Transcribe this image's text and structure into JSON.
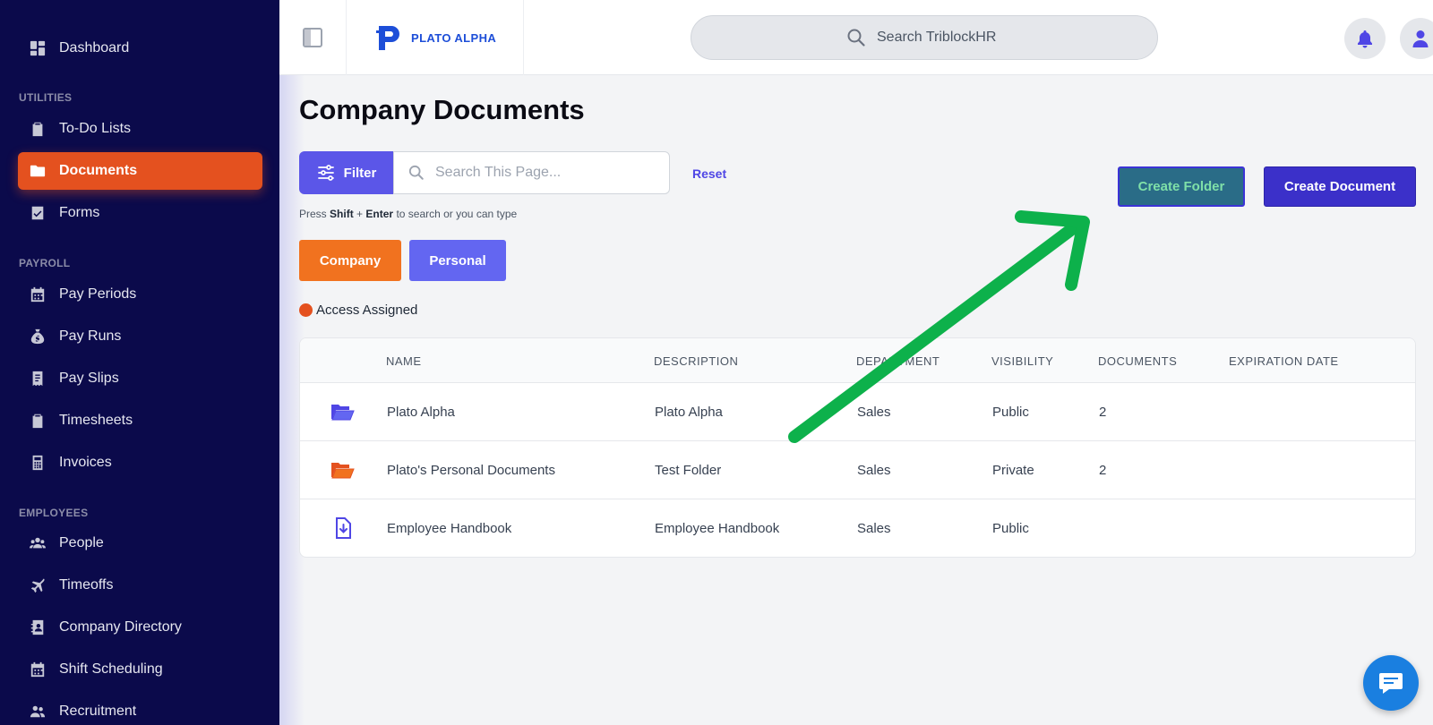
{
  "sidebar": {
    "items": [
      {
        "label": "Dashboard",
        "icon": "dashboard-icon"
      },
      {
        "label": "To-Do Lists",
        "icon": "clipboard-icon"
      },
      {
        "label": "Documents",
        "icon": "folder-icon",
        "active": true
      },
      {
        "label": "Forms",
        "icon": "form-check-icon"
      },
      {
        "label": "Pay Periods",
        "icon": "calendar-icon"
      },
      {
        "label": "Pay Runs",
        "icon": "money-bag-icon"
      },
      {
        "label": "Pay Slips",
        "icon": "receipt-icon"
      },
      {
        "label": "Timesheets",
        "icon": "clipboard-icon"
      },
      {
        "label": "Invoices",
        "icon": "calculator-icon"
      },
      {
        "label": "People",
        "icon": "people-icon"
      },
      {
        "label": "Timeoffs",
        "icon": "plane-icon"
      },
      {
        "label": "Company Directory",
        "icon": "address-book-icon"
      },
      {
        "label": "Shift Scheduling",
        "icon": "calendar-icon"
      },
      {
        "label": "Recruitment",
        "icon": "users-icon"
      }
    ],
    "sections": {
      "utilities": "UTILITIES",
      "payroll": "PAYROLL",
      "employees": "EMPLOYEES"
    }
  },
  "header": {
    "logo_text": "PLATO ALPHA",
    "search_placeholder": "Search TriblockHR"
  },
  "main": {
    "title": "Company Documents",
    "filter_label": "Filter",
    "search_placeholder": "Search This Page...",
    "reset_label": "Reset",
    "hint_prefix": "Press",
    "hint_key1": "Shift",
    "hint_plus": "+",
    "hint_key2": "Enter",
    "hint_suffix": "to search or you can type",
    "tabs": {
      "company": "Company",
      "personal": "Personal"
    },
    "access_label": "Access Assigned",
    "create_folder_label": "Create Folder",
    "create_document_label": "Create Document"
  },
  "table": {
    "headers": {
      "name": "NAME",
      "description": "DESCRIPTION",
      "department": "DEPARTMENT",
      "visibility": "VISIBILITY",
      "documents": "DOCUMENTS",
      "expiration": "EXPIRATION DATE"
    },
    "rows": [
      {
        "icon": "folder-open-icon",
        "name": "Plato Alpha",
        "description": "Plato Alpha",
        "department": "Sales",
        "visibility": "Public",
        "documents": "2",
        "expiration": ""
      },
      {
        "icon": "folder-open-icon",
        "name": "Plato's Personal Documents",
        "description": "Test Folder",
        "department": "Sales",
        "visibility": "Private",
        "documents": "2",
        "expiration": ""
      },
      {
        "icon": "file-download-icon",
        "name": "Employee Handbook",
        "description": "Employee Handbook",
        "department": "Sales",
        "visibility": "Public",
        "documents": "",
        "expiration": ""
      }
    ]
  },
  "colors": {
    "sidebar_bg": "#0b0a4b",
    "active_item": "#e4511f",
    "primary": "#5b56e8",
    "company_tab": "#f1721f",
    "annotation_arrow": "#0db14b"
  }
}
